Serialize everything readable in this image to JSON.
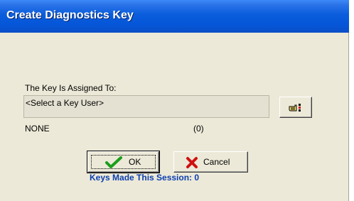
{
  "window": {
    "title": "Create Diagnostics Key"
  },
  "assignment": {
    "label": "The Key Is Assigned To:",
    "key_user_value": "<Select a Key User>",
    "select_user_icon": "hand-pointing-list-icon",
    "user_name": "NONE",
    "user_count": "(0)"
  },
  "buttons": {
    "ok_label": "OK",
    "ok_icon": "green-checkmark-icon",
    "cancel_label": "Cancel",
    "cancel_icon": "red-x-icon"
  },
  "status": {
    "keys_made": "Keys Made This Session: 0"
  },
  "colors": {
    "titlebar": "#0556d8",
    "dialog_bg": "#ece9d8",
    "status_text": "#0a3fb0"
  }
}
